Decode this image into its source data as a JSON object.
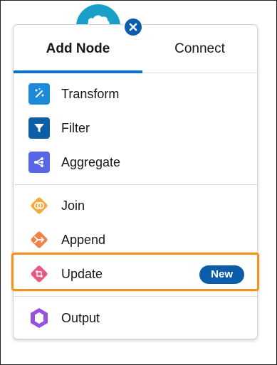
{
  "tabs": [
    {
      "label": "Add Node",
      "active": true
    },
    {
      "label": "Connect",
      "active": false
    }
  ],
  "items": [
    {
      "label": "Transform",
      "icon": "wand-icon",
      "color": "#1b8ad8"
    },
    {
      "label": "Filter",
      "icon": "filter-icon",
      "color": "#0b5fa6"
    },
    {
      "label": "Aggregate",
      "icon": "aggregate-icon",
      "color": "#5867e8"
    },
    {
      "label": "Join",
      "icon": "join-icon",
      "color": "#f4a93a"
    },
    {
      "label": "Append",
      "icon": "append-icon",
      "color": "#f0824a"
    },
    {
      "label": "Update",
      "icon": "update-icon",
      "color": "#e55a83",
      "badge": "New"
    },
    {
      "label": "Output",
      "icon": "output-icon",
      "color": "#9651e0"
    }
  ],
  "colors": {
    "accent": "#0b72d4",
    "highlight": "#f39320",
    "badge": "#0b5cab",
    "cloud": "#1aa0c8"
  }
}
